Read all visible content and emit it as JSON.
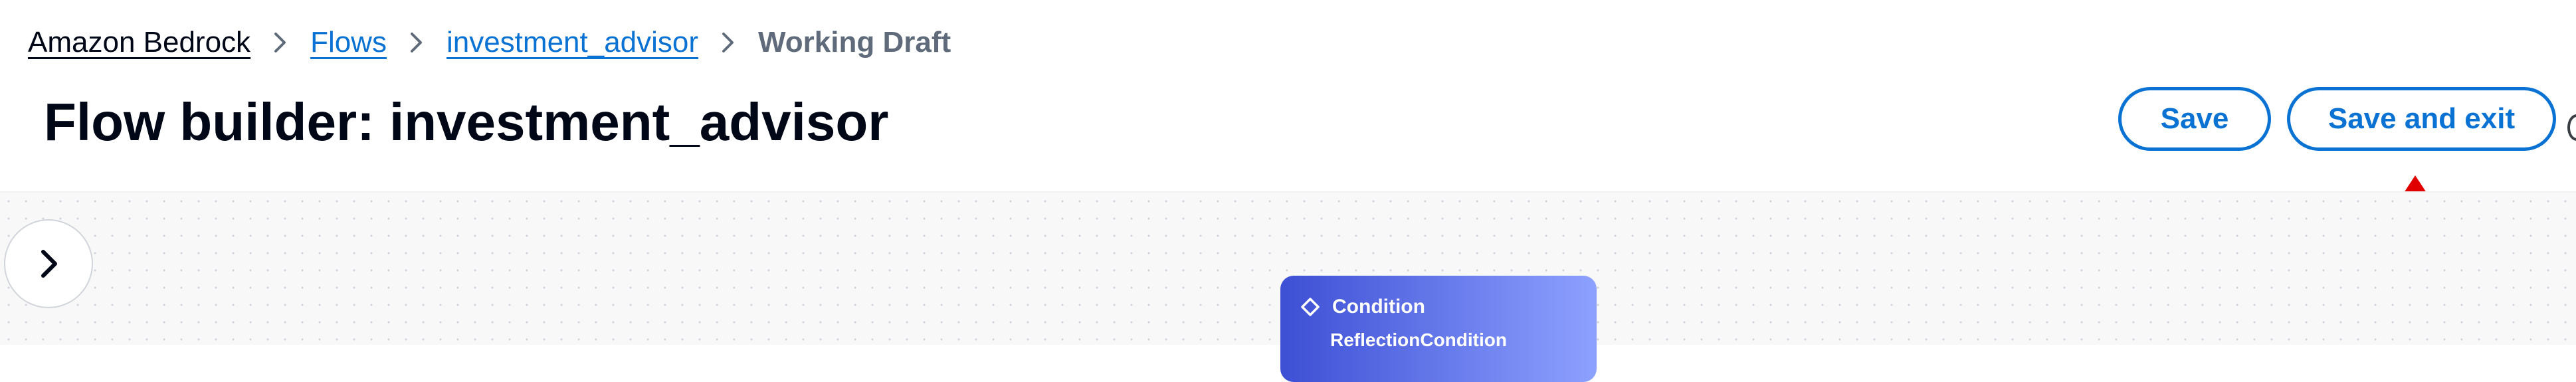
{
  "breadcrumb": {
    "items": [
      {
        "label": "Amazon Bedrock"
      },
      {
        "label": "Flows"
      },
      {
        "label": "investment_advisor"
      },
      {
        "label": "Working Draft"
      }
    ]
  },
  "header": {
    "title": "Flow builder: investment_advisor",
    "save_label": "Save",
    "save_exit_label": "Save and exit"
  },
  "canvas": {
    "panel_toggle_icon": "chevron-right-icon",
    "node": {
      "type": "Condition",
      "name": "ReflectionCondition",
      "icon": "diamond-icon"
    }
  },
  "colors": {
    "link": "#0972d3",
    "text": "#000716",
    "muted": "#5f6b7a",
    "annotation_arrow": "#e00000",
    "node_gradient_start": "#3d4fd4",
    "node_gradient_end": "#8da1ff"
  }
}
